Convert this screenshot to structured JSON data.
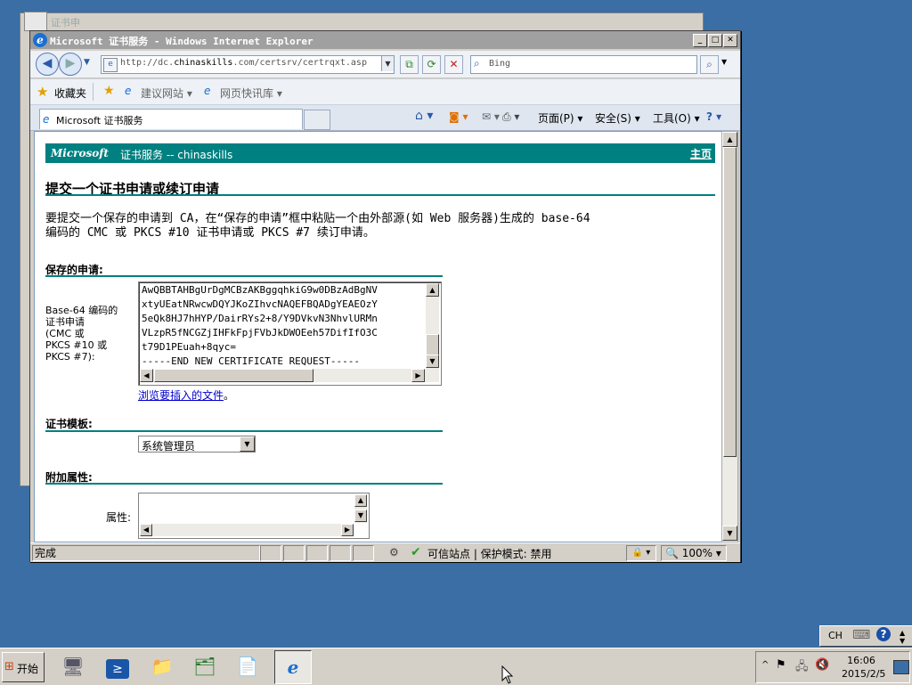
{
  "background_window": {
    "title": "证书申"
  },
  "window": {
    "title": "Microsoft 证书服务 - Windows Internet Explorer",
    "min_label": "_",
    "max_label": "□",
    "close_label": "✕"
  },
  "nav": {
    "back": "◀",
    "forward": "▶",
    "url_prefix": "http://dc.",
    "url_host": "chinaskills",
    "url_suffix": ".com/certsrv/certrqxt.asp",
    "search_placeholder": "Bing"
  },
  "favorites": {
    "label": "收藏夹",
    "item1": "建议网站",
    "item2": "网页快讯库"
  },
  "tab": {
    "title": "Microsoft 证书服务"
  },
  "commands": {
    "page": "页面(P)",
    "safety": "安全(S)",
    "tools": "工具(O)"
  },
  "page": {
    "brand": "Microsoft",
    "service": "证书服务  --  chinaskills",
    "home": "主页",
    "heading": "提交一个证书申请或续订申请",
    "intro_line1": "要提交一个保存的申请到 CA，在“保存的申请”框中粘贴一个由外部源(如 Web 服务器)生成的 base-64",
    "intro_line2": "编码的 CMC 或 PKCS #10 证书申请或 PKCS #7 续订申请。",
    "saved_section": "保存的申请:",
    "saved_label_lines": [
      "Base-64 编码的",
      "证书申请",
      "(CMC 或",
      "PKCS #10 或",
      "PKCS #7):"
    ],
    "request_lines": [
      "AwQBBTAHBgUrDgMCBzAKBggqhkiG9w0DBzAdBgNV",
      "xtyUEatNRwcwDQYJKoZIhvcNAQEFBQADgYEAEOzY",
      "5eQk8HJ7hHYP/DairRYs2+8/Y9DVkvN3NhvlURMn",
      "VLzpR5fNCGZjIHFkFpjFVbJkDWOEeh57DifIfO3C",
      "t79D1PEuah+8qyc=",
      "-----END NEW CERTIFICATE REQUEST-----"
    ],
    "browse_link": "浏览要插入的文件",
    "browse_suffix": "。",
    "template_section": "证书模板:",
    "template_value": "系统管理员",
    "attr_section": "附加属性:",
    "attr_label": "属性:"
  },
  "status": {
    "text": "完成",
    "zone": "可信站点 | 保护模式: 禁用",
    "zoom": "100%"
  },
  "taskbar": {
    "start": "开始",
    "lang": "CH",
    "time": "16:06",
    "date": "2015/2/5"
  }
}
